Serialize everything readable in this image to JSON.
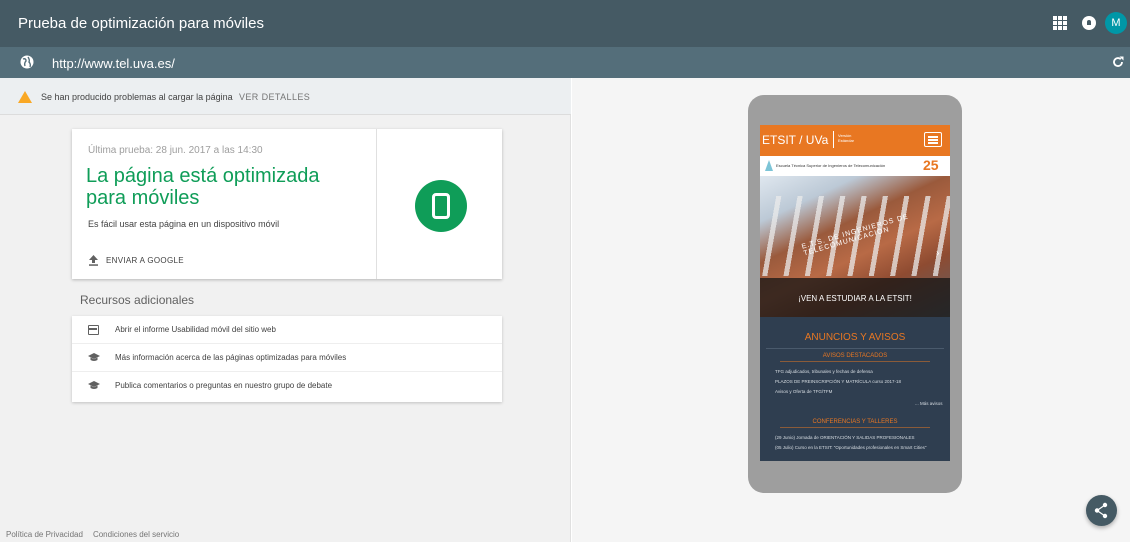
{
  "app": {
    "title": "Prueba de optimización para móviles",
    "avatar_initial": "M"
  },
  "urlbar": {
    "url": "http://www.tel.uva.es/"
  },
  "warning": {
    "text": "Se han producido problemas al cargar la página",
    "link": "VER DETALLES"
  },
  "result": {
    "last_test": "Última prueba: 28 jun. 2017 a las 14:30",
    "heading": "La página está optimizada para móviles",
    "subtext": "Es fácil usar esta página en un dispositivo móvil",
    "send_label": "ENVIAR A GOOGLE"
  },
  "resources": {
    "title": "Recursos adicionales",
    "items": [
      {
        "label": "Abrir el informe Usabilidad móvil del sitio web",
        "icon": "report-icon"
      },
      {
        "label": "Más información acerca de las páginas optimizadas para móviles",
        "icon": "school-icon"
      },
      {
        "label": "Publica comentarios o preguntas en nuestro grupo de debate",
        "icon": "school-icon"
      }
    ]
  },
  "footer": {
    "privacy": "Política de Privacidad",
    "terms": "Condiciones del servicio"
  },
  "preview": {
    "brand": "ETSIT / UVa",
    "brand_tag": "Versión Estándar",
    "school_name": "Escuela Técnica Superior de Ingenieros de Telecomunicación",
    "anniversary": "25",
    "hero_building_text": "E.T.S. DE INGENIEROS DE TELECOMUNICACIÓN",
    "hero_caption": "¡VEN A ESTUDIAR A LA ETSIT!",
    "news_title": "ANUNCIOS Y AVISOS",
    "featured_title": "AVISOS DESTACADOS",
    "featured_items": [
      "TFG adjudicados, tribunales y fechas de defensa",
      "PLAZOS DE PREINSCRIPCIÓN Y MATRÍCULA curso 2017-18",
      "Avisos y Oferta de TFG/TFM"
    ],
    "more_link": "... Más avisos",
    "events_title": "CONFERENCIAS Y TALLERES",
    "event_items": [
      "(29 Junio) Jornada de ORIENTACIÓN Y SALIDAS PROFESIONALES",
      "(05 Julio) Curso en la ETSIT: \"Oportunidades profesionales en Smart Cities\""
    ]
  },
  "colors": {
    "topbar": "#455a64",
    "urlbar": "#546e7a",
    "success": "#0f9d58",
    "site_accent": "#e87722",
    "site_bg": "#2f3e50",
    "warning": "#f9a825"
  }
}
